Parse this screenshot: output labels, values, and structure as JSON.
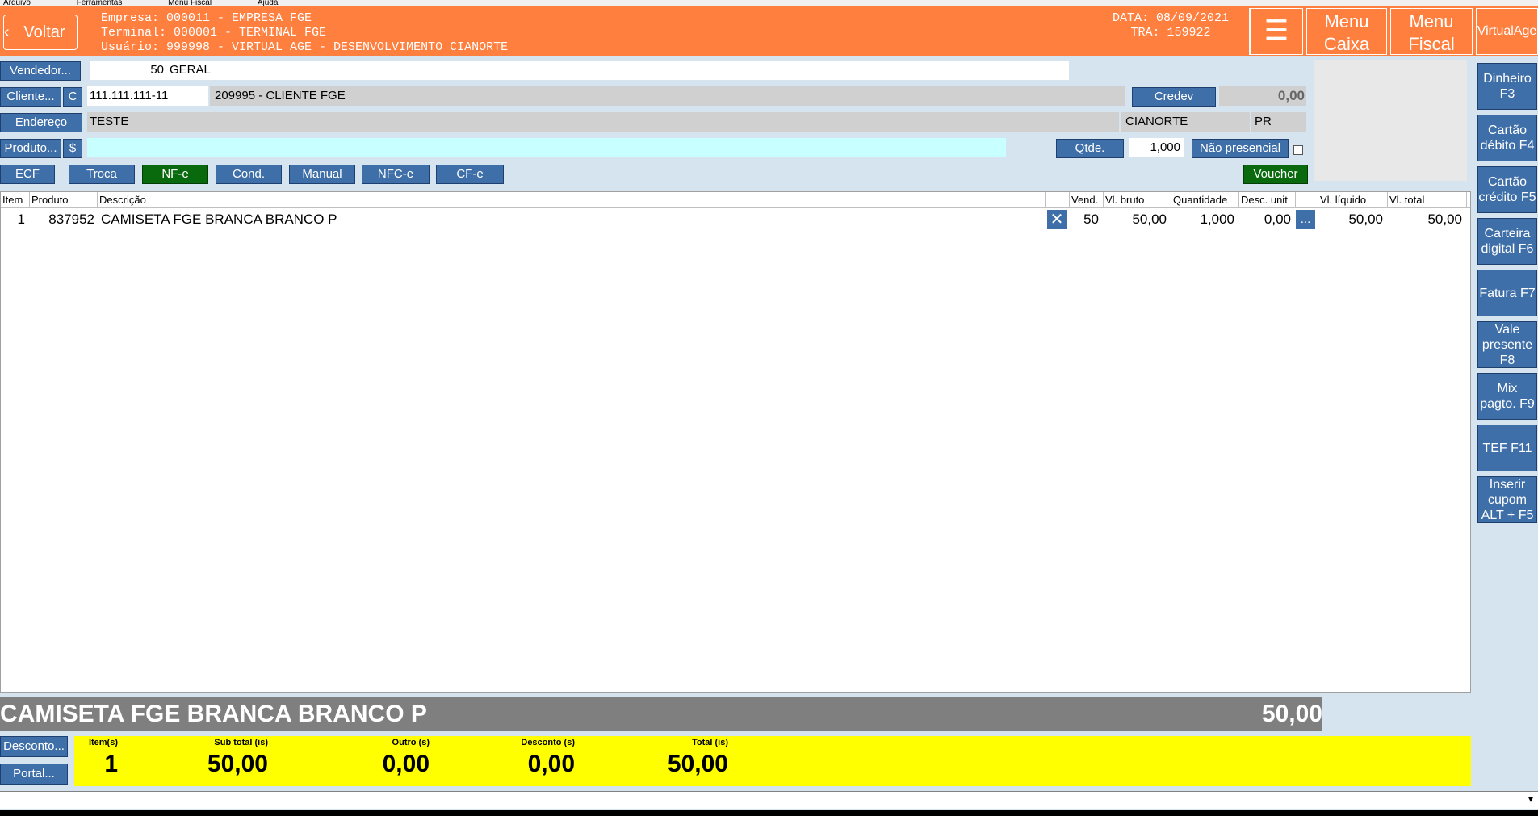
{
  "menubar": [
    "Arquivo",
    "Ferramentas",
    "Menu Fiscal",
    "Ajuda"
  ],
  "header": {
    "back_label": "Voltar",
    "empresa": "Empresa: 000011 - EMPRESA FGE",
    "terminal": "Terminal: 000001 - TERMINAL FGE",
    "usuario": "Usuário: 999998 - VIRTUAL AGE - DESENVOLVIMENTO CIANORTE",
    "data": "DATA: 08/09/2021",
    "tra": "TRA: 159922",
    "menu_caixa": "Menu Caixa",
    "menu_fiscal": "Menu Fiscal",
    "brand": "VirtualAge"
  },
  "form": {
    "vendedor_btn": "Vendedor...",
    "vendedor_code": "50",
    "vendedor_name": "GERAL",
    "cliente_btn": "Cliente...",
    "cliente_c": "C",
    "cliente_doc": "111.111.111-11",
    "cliente_name": "209995 - CLIENTE FGE",
    "credev_btn": "Credev",
    "credev_value": "0,00",
    "endereco_btn": "Endereço",
    "endereco": "TESTE",
    "cidade": "CIANORTE",
    "uf": "PR",
    "produto_btn": "Produto...",
    "produto_dollar": "$",
    "produto_value": "",
    "qtde_btn": "Qtde.",
    "qtde_value": "1,000",
    "nao_presencial": "Não presencial"
  },
  "doc_buttons": [
    "ECF",
    "Troca",
    "NF-e",
    "Cond.",
    "Manual",
    "NFC-e",
    "CF-e"
  ],
  "voucher": "Voucher",
  "table": {
    "headers": [
      "Item",
      "Produto",
      "Descrição",
      "Vend.",
      "Vl. bruto",
      "Quantidade",
      "Desc. unit",
      "Vl. líquido",
      "Vl. total"
    ],
    "rows": [
      {
        "item": "1",
        "produto": "837952",
        "descricao": "CAMISETA FGE BRANCA BRANCO P",
        "vend": "50",
        "bruto": "50,00",
        "qtd": "1,000",
        "desc": "0,00",
        "liquido": "50,00",
        "total": "50,00"
      }
    ]
  },
  "side_buttons": [
    "Dinheiro F3",
    "Cartão débito F4",
    "Cartão crédito F5",
    "Carteira digital F6",
    "Fatura F7",
    "Vale presente F8",
    "Mix pagto. F9",
    "TEF F11",
    "Inserir cupom ALT + F5"
  ],
  "current_item": {
    "desc": "CAMISETA FGE BRANCA BRANCO P",
    "value": "50,00"
  },
  "bottom_buttons": {
    "desconto": "Desconto...",
    "portal": "Portal..."
  },
  "totals": [
    {
      "label": "Item(s)",
      "value": "1"
    },
    {
      "label": "Sub total (is)",
      "value": "50,00"
    },
    {
      "label": "Outro (s)",
      "value": "0,00"
    },
    {
      "label": "Desconto (s)",
      "value": "0,00"
    },
    {
      "label": "Total (is)",
      "value": "50,00"
    }
  ],
  "colors": {
    "header": "#ff7f3f",
    "button": "#3f6fa8",
    "totals": "#ffff00"
  }
}
